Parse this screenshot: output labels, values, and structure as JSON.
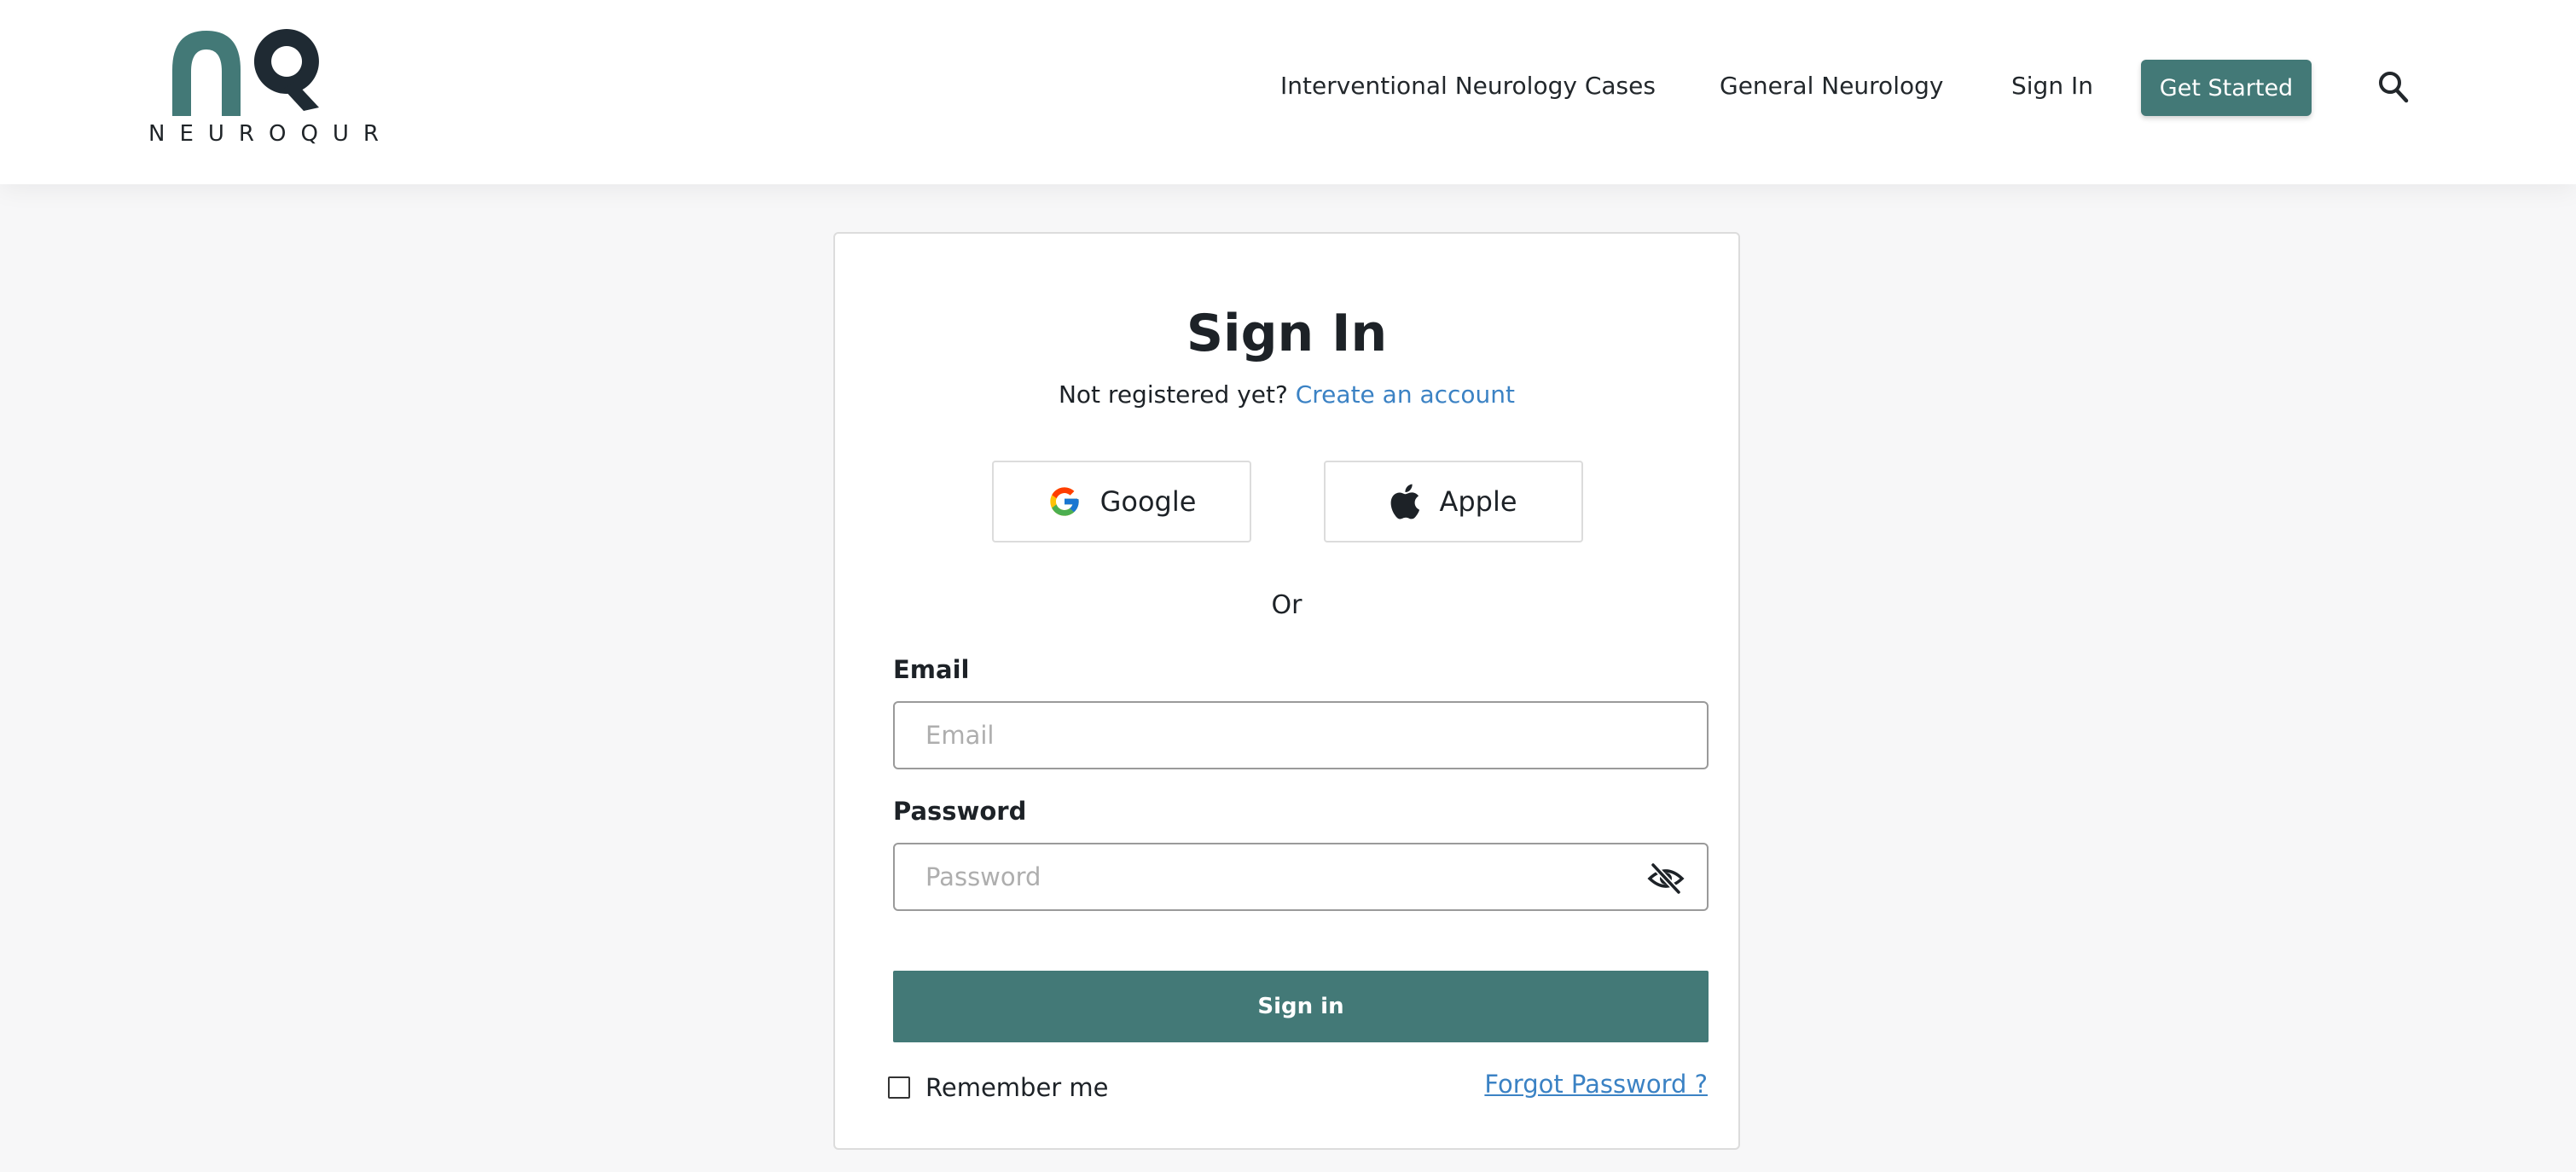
{
  "brand": {
    "name": "NEUROQUR",
    "primary_color": "#437977",
    "dark_color": "#1f2a33",
    "link_color": "#3b82c4"
  },
  "header": {
    "nav": [
      {
        "label": "Interventional Neurology Cases"
      },
      {
        "label": "General Neurology"
      },
      {
        "label": "Sign In"
      }
    ],
    "cta_label": "Get Started",
    "search_icon": "search-icon"
  },
  "signin_card": {
    "title": "Sign In",
    "register_prompt": "Not registered yet?",
    "register_link": "Create an account",
    "social": {
      "google_label": "Google",
      "apple_label": "Apple"
    },
    "divider": "Or",
    "email": {
      "label": "Email",
      "placeholder": "Email",
      "value": ""
    },
    "password": {
      "label": "Password",
      "placeholder": "Password",
      "value": "",
      "toggle_icon": "eye-off-icon"
    },
    "submit_label": "Sign in",
    "remember_label": "Remember me",
    "remember_checked": false,
    "forgot_label": "Forgot Password ?"
  }
}
